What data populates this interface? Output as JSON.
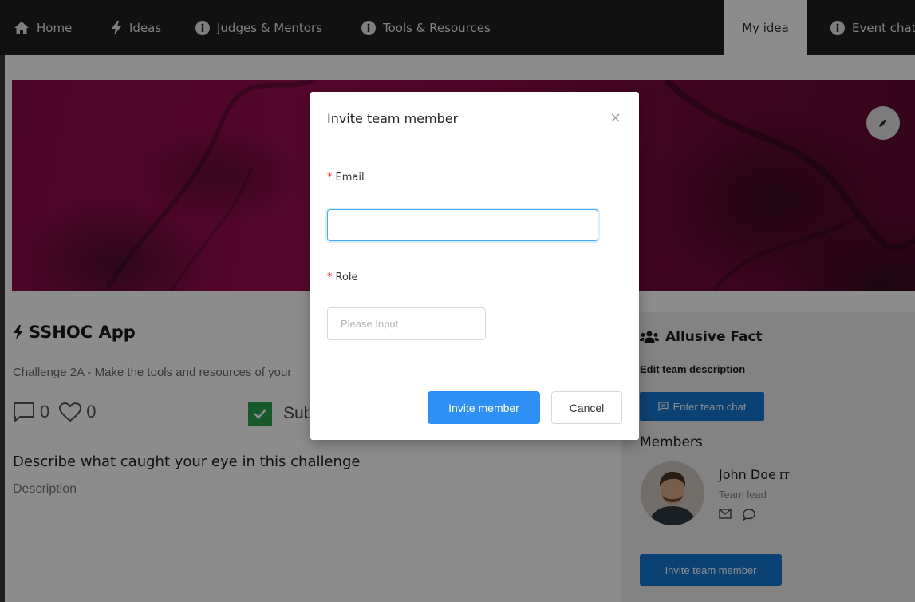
{
  "nav": {
    "items": [
      {
        "label": "Home",
        "icon": "home-icon"
      },
      {
        "label": "Ideas",
        "icon": "bolt-icon"
      },
      {
        "label": "Judges & Mentors",
        "icon": "info-circle-icon"
      },
      {
        "label": "Tools & Resources",
        "icon": "info-circle-icon"
      },
      {
        "label": "My idea",
        "active": true
      },
      {
        "label": "Event chat",
        "icon": "info-circle-icon"
      }
    ]
  },
  "idea": {
    "title": "SSHOC App",
    "challenge": "Challenge 2A - Make the tools and resources of your",
    "comments_count": "0",
    "likes_count": "0",
    "submitted_label": "Submitted",
    "describe_heading": "Describe what caught your eye in this challenge",
    "description": "Description"
  },
  "team": {
    "name": "Allusive Fact",
    "edit_description": "Edit team description",
    "chat_button": "Enter team chat",
    "members_heading": "Members",
    "members": [
      {
        "name": "John Doe",
        "country": "IT",
        "role": "Team lead"
      }
    ],
    "invite_button": "Invite team member"
  },
  "modal": {
    "title": "Invite team member",
    "email_label": "Email",
    "email_value": "",
    "role_label": "Role",
    "role_placeholder": "Please Input",
    "invite_button": "Invite member",
    "cancel_button": "Cancel"
  },
  "colors": {
    "navbar_bg": "#1f1f1f",
    "primary": "#2e90f5",
    "required": "#f5222d",
    "check_green": "#2ba24c",
    "banner": "#8b0b49"
  }
}
